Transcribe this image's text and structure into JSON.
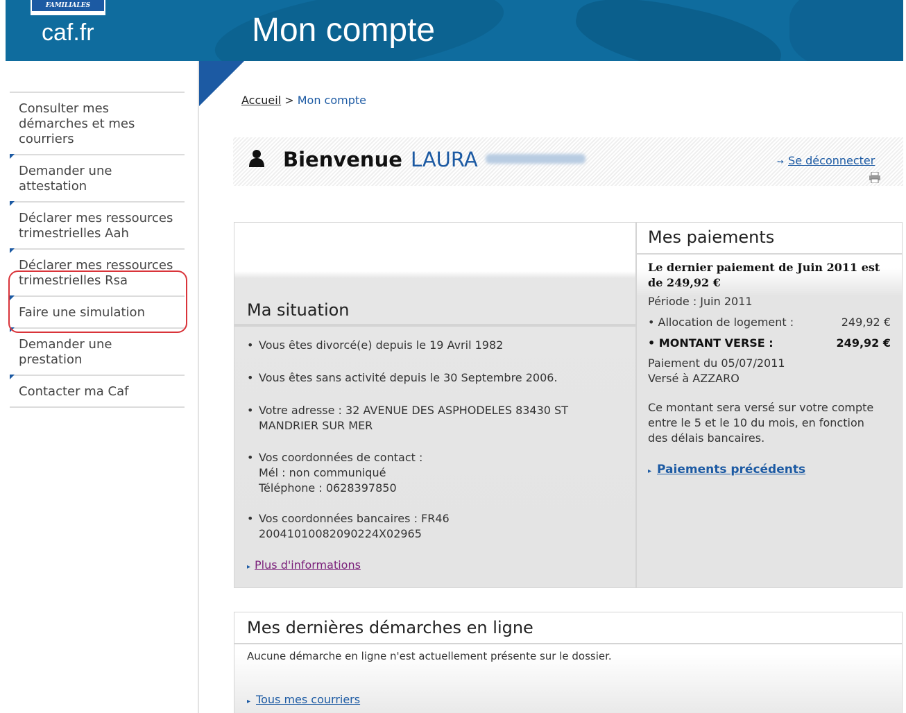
{
  "header": {
    "logo_tag": "FAMILIALES",
    "logo": "caf.fr",
    "title": "Mon compte"
  },
  "sidebar": {
    "items": [
      {
        "label": "Consulter mes démarches et mes courriers"
      },
      {
        "label": "Demander une attestation"
      },
      {
        "label": "Déclarer mes ressources trimestrielles Aah"
      },
      {
        "label": "Déclarer mes ressources trimestrielles Rsa"
      },
      {
        "label": "Faire une simulation"
      },
      {
        "label": "Demander une prestation"
      },
      {
        "label": "Contacter ma Caf"
      }
    ]
  },
  "breadcrumb": {
    "home": "Accueil",
    "separator": ">",
    "current": "Mon compte"
  },
  "welcome": {
    "label": "Bienvenue",
    "first_name": "LAURA",
    "logout": "Se déconnecter"
  },
  "situation": {
    "title": "Ma situation",
    "items": [
      "Vous êtes divorcé(e) depuis le 19 Avril 1982",
      "Vous êtes sans activité depuis le 30 Septembre 2006.",
      "Votre adresse : 32 AVENUE DES ASPHODELES 83430 ST MANDRIER SUR MER",
      "Vos coordonnées de contact :",
      "Mél : non communiqué",
      "Téléphone : 0628397850",
      "Vos coordonnées bancaires : FR46 20041010082090224X02965"
    ],
    "more_link": "Plus d'informations"
  },
  "payments": {
    "title": "Mes paiements",
    "last_payment": "Le dernier paiement de Juin 2011 est de 249,92 €",
    "period": "Période : Juin 2011",
    "rows": [
      {
        "label": "Allocation de logement :",
        "amount": "249,92 €"
      },
      {
        "label": "MONTANT VERSE :",
        "amount": "249,92 €"
      }
    ],
    "paid_date": "Paiement du 05/07/2011",
    "paid_to": "Versé à AZZARO",
    "note": "Ce montant sera versé sur votre compte entre le 5 et le 10 du mois, en fonction des délais bancaires.",
    "previous_link": "Paiements précédents"
  },
  "demarches": {
    "title": "Mes dernières démarches en ligne",
    "empty": "Aucune démarche en ligne n'est actuellement présente sur le dossier.",
    "link": "Tous mes courriers"
  },
  "colors": {
    "header": "#0f6c9e",
    "accent": "#1c5aa3",
    "highlight": "#d9343a"
  }
}
